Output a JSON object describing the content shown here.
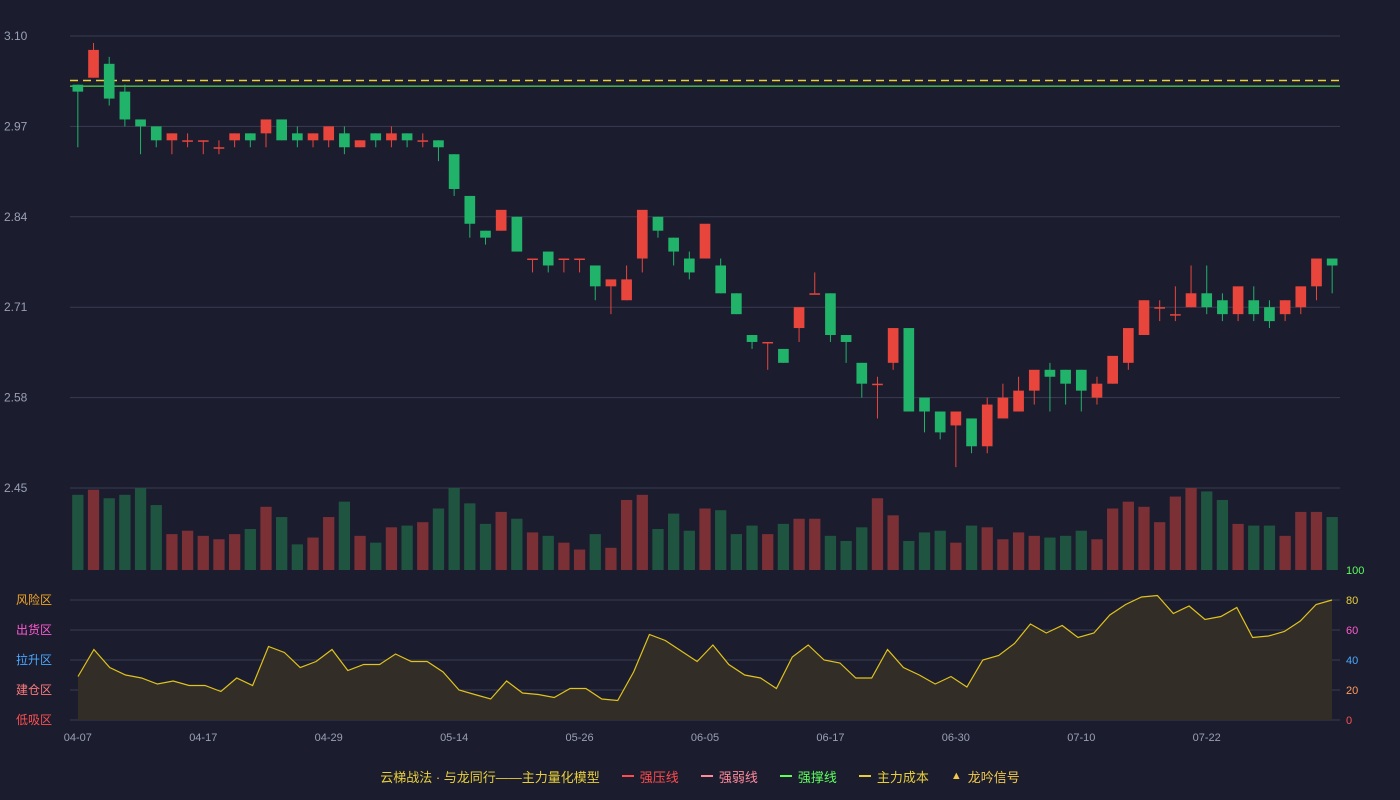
{
  "colors": {
    "background": "#1b1c2e",
    "grid": "#3a3b50",
    "up": "#e8463c",
    "down": "#21b36a",
    "vol_up": "#7a3035",
    "vol_down": "#1f5540",
    "strong_resist": "#ff4b4b",
    "weak_resist": "#ff8a9a",
    "strong_support": "#5cff5c",
    "main_cost": "#e8cf3a",
    "signal": "#f2c94c",
    "oscillator_line": "#e0c31c",
    "oscillator_fill": "#332d27",
    "axis_text": "#9aa0b4"
  },
  "chart_data": [
    {
      "type": "candlestick",
      "title": "",
      "x_tick_labels": [
        "04-07",
        "04-17",
        "04-29",
        "05-14",
        "05-26",
        "06-05",
        "06-17",
        "06-30",
        "07-10",
        "07-22"
      ],
      "x_tick_indices": [
        0,
        8,
        16,
        24,
        32,
        40,
        48,
        56,
        64,
        72
      ],
      "ylim": [
        2.45,
        3.1
      ],
      "y_ticks": [
        "3.10",
        "2.97",
        "2.84",
        "2.71",
        "2.58",
        "2.45"
      ],
      "horizontal_lines": {
        "main_cost": 3.036,
        "strong_support": 3.028
      },
      "candles": [
        [
          3.03,
          3.03,
          2.94,
          3.02
        ],
        [
          3.04,
          3.09,
          3.04,
          3.08
        ],
        [
          3.06,
          3.07,
          3.0,
          3.01
        ],
        [
          3.02,
          3.03,
          2.97,
          2.98
        ],
        [
          2.98,
          2.98,
          2.93,
          2.97
        ],
        [
          2.97,
          2.97,
          2.94,
          2.95
        ],
        [
          2.95,
          2.96,
          2.93,
          2.96
        ],
        [
          2.95,
          2.96,
          2.94,
          2.95
        ],
        [
          2.95,
          2.95,
          2.93,
          2.95
        ],
        [
          2.94,
          2.95,
          2.93,
          2.94
        ],
        [
          2.95,
          2.96,
          2.94,
          2.96
        ],
        [
          2.96,
          2.96,
          2.94,
          2.95
        ],
        [
          2.96,
          2.97,
          2.94,
          2.98
        ],
        [
          2.98,
          2.98,
          2.95,
          2.95
        ],
        [
          2.96,
          2.97,
          2.94,
          2.95
        ],
        [
          2.95,
          2.96,
          2.94,
          2.96
        ],
        [
          2.95,
          2.97,
          2.94,
          2.97
        ],
        [
          2.96,
          2.97,
          2.93,
          2.94
        ],
        [
          2.94,
          2.95,
          2.94,
          2.95
        ],
        [
          2.96,
          2.96,
          2.94,
          2.95
        ],
        [
          2.95,
          2.97,
          2.94,
          2.96
        ],
        [
          2.96,
          2.96,
          2.94,
          2.95
        ],
        [
          2.95,
          2.96,
          2.94,
          2.95
        ],
        [
          2.95,
          2.95,
          2.92,
          2.94
        ],
        [
          2.93,
          2.93,
          2.87,
          2.88
        ],
        [
          2.87,
          2.87,
          2.81,
          2.83
        ],
        [
          2.82,
          2.82,
          2.8,
          2.81
        ],
        [
          2.82,
          2.84,
          2.82,
          2.85
        ],
        [
          2.84,
          2.84,
          2.79,
          2.79
        ],
        [
          2.78,
          2.78,
          2.76,
          2.78
        ],
        [
          2.79,
          2.79,
          2.76,
          2.77
        ],
        [
          2.78,
          2.78,
          2.76,
          2.78
        ],
        [
          2.78,
          2.78,
          2.76,
          2.78
        ],
        [
          2.77,
          2.77,
          2.72,
          2.74
        ],
        [
          2.74,
          2.74,
          2.7,
          2.75
        ],
        [
          2.72,
          2.77,
          2.72,
          2.75
        ],
        [
          2.78,
          2.81,
          2.76,
          2.85
        ],
        [
          2.84,
          2.84,
          2.81,
          2.82
        ],
        [
          2.81,
          2.81,
          2.77,
          2.79
        ],
        [
          2.78,
          2.79,
          2.75,
          2.76
        ],
        [
          2.78,
          2.82,
          2.78,
          2.83
        ],
        [
          2.77,
          2.78,
          2.73,
          2.73
        ],
        [
          2.73,
          2.73,
          2.7,
          2.7
        ],
        [
          2.67,
          2.67,
          2.65,
          2.66
        ],
        [
          2.66,
          2.66,
          2.62,
          2.66
        ],
        [
          2.65,
          2.65,
          2.63,
          2.63
        ],
        [
          2.68,
          2.7,
          2.66,
          2.71
        ],
        [
          2.73,
          2.76,
          2.73,
          2.73
        ],
        [
          2.73,
          2.73,
          2.66,
          2.67
        ],
        [
          2.67,
          2.67,
          2.63,
          2.66
        ],
        [
          2.63,
          2.63,
          2.58,
          2.6
        ],
        [
          2.6,
          2.61,
          2.55,
          2.6
        ],
        [
          2.63,
          2.68,
          2.62,
          2.68
        ],
        [
          2.68,
          2.68,
          2.57,
          2.56
        ],
        [
          2.58,
          2.58,
          2.53,
          2.56
        ],
        [
          2.56,
          2.56,
          2.52,
          2.53
        ],
        [
          2.54,
          2.55,
          2.48,
          2.56
        ],
        [
          2.55,
          2.55,
          2.5,
          2.51
        ],
        [
          2.51,
          2.58,
          2.5,
          2.57
        ],
        [
          2.55,
          2.6,
          2.55,
          2.58
        ],
        [
          2.56,
          2.61,
          2.56,
          2.59
        ],
        [
          2.59,
          2.61,
          2.57,
          2.62
        ],
        [
          2.62,
          2.63,
          2.56,
          2.61
        ],
        [
          2.62,
          2.62,
          2.57,
          2.6
        ],
        [
          2.62,
          2.62,
          2.56,
          2.59
        ],
        [
          2.58,
          2.61,
          2.57,
          2.6
        ],
        [
          2.6,
          2.62,
          2.6,
          2.64
        ],
        [
          2.63,
          2.66,
          2.62,
          2.68
        ],
        [
          2.67,
          2.72,
          2.67,
          2.72
        ],
        [
          2.71,
          2.72,
          2.69,
          2.71
        ],
        [
          2.7,
          2.74,
          2.69,
          2.7
        ],
        [
          2.71,
          2.77,
          2.71,
          2.73
        ],
        [
          2.73,
          2.77,
          2.7,
          2.71
        ],
        [
          2.72,
          2.73,
          2.69,
          2.7
        ],
        [
          2.7,
          2.73,
          2.69,
          2.74
        ],
        [
          2.72,
          2.74,
          2.69,
          2.7
        ],
        [
          2.71,
          2.72,
          2.68,
          2.69
        ],
        [
          2.7,
          2.72,
          2.69,
          2.72
        ],
        [
          2.71,
          2.72,
          2.7,
          2.74
        ],
        [
          2.74,
          2.76,
          2.72,
          2.78
        ],
        [
          2.78,
          2.78,
          2.73,
          2.77
        ]
      ]
    },
    {
      "type": "bar",
      "title": "",
      "values": [
        44,
        47,
        42,
        44,
        48,
        38,
        21,
        23,
        20,
        18,
        21,
        24,
        37,
        31,
        15,
        19,
        31,
        40,
        20,
        16,
        25,
        26,
        28,
        36,
        48,
        39,
        27,
        34,
        30,
        22,
        20,
        16,
        12,
        21,
        13,
        41,
        44,
        24,
        33,
        23,
        36,
        35,
        21,
        26,
        21,
        27,
        30,
        30,
        20,
        17,
        25,
        42,
        32,
        17,
        22,
        23,
        16,
        26,
        25,
        18,
        22,
        20,
        19,
        20,
        23,
        18,
        36,
        40,
        37,
        28,
        43,
        48,
        46,
        41,
        27,
        26,
        26,
        20,
        34,
        34,
        31
      ],
      "ylim": [
        0,
        48
      ]
    },
    {
      "type": "line",
      "title": "",
      "ylim": [
        0,
        100
      ],
      "y_ticks_right": [
        "100",
        "80",
        "60",
        "40",
        "20",
        "0"
      ],
      "y_zone_labels": [
        "风险区",
        "出货区",
        "拉升区",
        "建仓区",
        "低吸区"
      ],
      "values": [
        29,
        47,
        35,
        30,
        28,
        24,
        26,
        23,
        23,
        19,
        28,
        23,
        49,
        45,
        35,
        39,
        47,
        33,
        37,
        37,
        44,
        39,
        39,
        32,
        20,
        17,
        14,
        26,
        18,
        17,
        15,
        21,
        21,
        14,
        13,
        32,
        57,
        53,
        46,
        39,
        50,
        37,
        30,
        28,
        21,
        42,
        50,
        40,
        38,
        28,
        28,
        47,
        35,
        30,
        24,
        29,
        22,
        40,
        43,
        51,
        64,
        58,
        63,
        55,
        58,
        70,
        77,
        82,
        83,
        71,
        76,
        67,
        69,
        75,
        55,
        56,
        59,
        66,
        77,
        80
      ]
    }
  ],
  "legend": {
    "title": "云梯战法 · 与龙同行——主力量化模型",
    "items": [
      {
        "label": "强压线",
        "kind": "solid",
        "color": "#ff4b4b"
      },
      {
        "label": "强弱线",
        "kind": "dash",
        "color": "#ff8a9a"
      },
      {
        "label": "强撑线",
        "kind": "solid",
        "color": "#5cff5c"
      },
      {
        "label": "主力成本",
        "kind": "dash",
        "color": "#e8cf3a"
      },
      {
        "label": "龙吟信号",
        "kind": "triangle",
        "color": "#f2c94c"
      }
    ]
  }
}
